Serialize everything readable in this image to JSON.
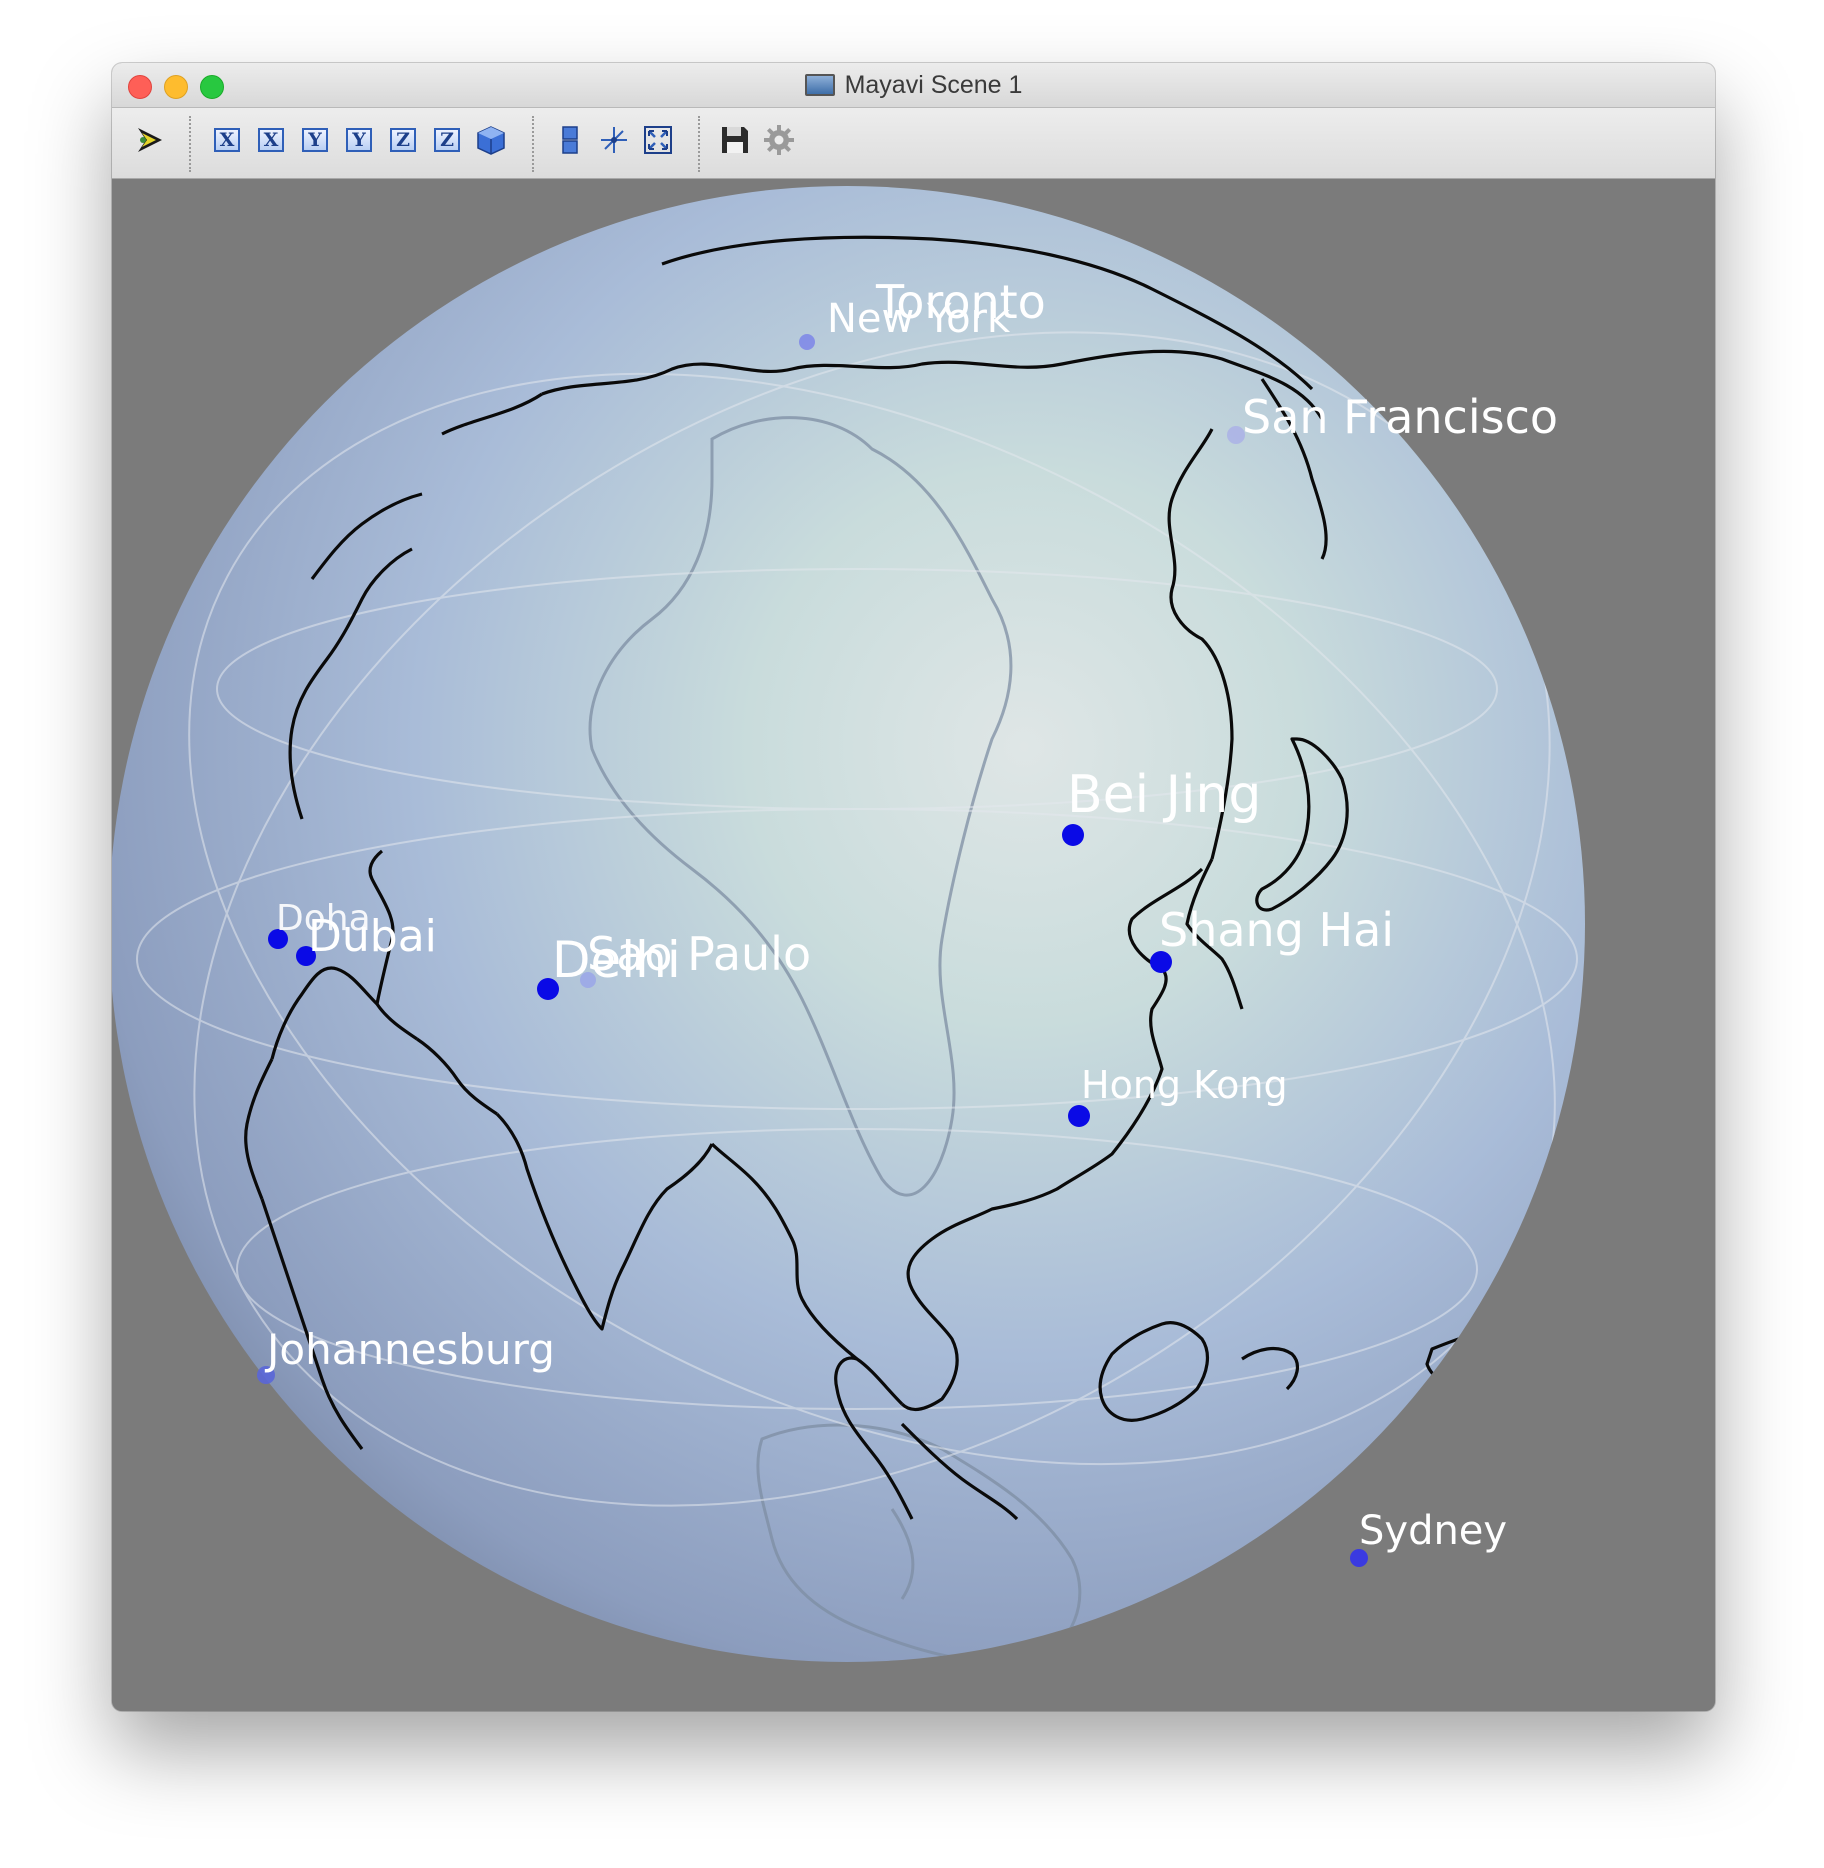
{
  "window": {
    "title": "Mayavi Scene 1"
  },
  "toolbar": {
    "buttons": [
      {
        "name": "mayavi-pipeline-icon",
        "label": ""
      },
      {
        "name": "view-x-pos-button",
        "label": "X"
      },
      {
        "name": "view-x-neg-button",
        "label": "X"
      },
      {
        "name": "view-y-pos-button",
        "label": "Y"
      },
      {
        "name": "view-y-neg-button",
        "label": "Y"
      },
      {
        "name": "view-z-pos-button",
        "label": "Z"
      },
      {
        "name": "view-z-neg-button",
        "label": "Z"
      },
      {
        "name": "isometric-view-icon",
        "label": ""
      },
      {
        "name": "parallel-projection-icon",
        "label": ""
      },
      {
        "name": "axes-indicator-icon",
        "label": ""
      },
      {
        "name": "full-screen-icon",
        "label": ""
      },
      {
        "name": "save-icon",
        "label": ""
      },
      {
        "name": "configure-gear-icon",
        "label": ""
      }
    ]
  },
  "scene": {
    "background_color": "#7b7b7b",
    "cities": [
      {
        "name": "Toronto"
      },
      {
        "name": "New York"
      },
      {
        "name": "San Francisco"
      },
      {
        "name": "Bei Jing"
      },
      {
        "name": "Shang Hai"
      },
      {
        "name": "Hong Kong"
      },
      {
        "name": "Doha"
      },
      {
        "name": "Dubai"
      },
      {
        "name": "Delhi"
      },
      {
        "name": "Sao Paulo"
      },
      {
        "name": "Johannesburg"
      },
      {
        "name": "Sydney"
      }
    ],
    "marker_color": "#0000ee"
  }
}
